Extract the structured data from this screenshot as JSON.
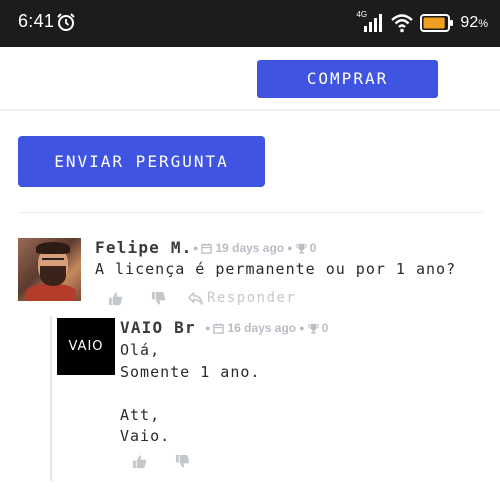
{
  "status_bar": {
    "time": "6:41",
    "network": "4G",
    "battery_percent": "92",
    "battery_symbol": "%",
    "battery_level": 0.92,
    "battery_color": "#f0a020"
  },
  "buy_button": {
    "label": "COMPRAR"
  },
  "ask_button": {
    "label": "ENVIAR PERGUNTA"
  },
  "comment": {
    "author": "Felipe M.",
    "date": "19 days ago",
    "votes": "0",
    "text": "A licença é permanente ou por 1 ano?",
    "reply_label": "Responder"
  },
  "reply": {
    "author": "VAIO Br",
    "date": "16 days ago",
    "votes": "0",
    "logo_text": "VAIO",
    "lines": [
      "Olá,",
      "Somente 1 ano.",
      "",
      "Att,",
      "Vaio."
    ]
  },
  "icons": {
    "alarm": "alarm-icon",
    "signal": "signal-icon",
    "wifi": "wifi-icon",
    "battery": "battery-icon",
    "calendar": "calendar-icon",
    "trophy": "trophy-icon",
    "thumbs_up": "thumbs-up-icon",
    "thumbs_down": "thumbs-down-icon",
    "reply": "reply-icon"
  },
  "colors": {
    "accent": "#3f55e2",
    "status_bar": "#1c1c1c",
    "muted": "#b8bcc4"
  }
}
